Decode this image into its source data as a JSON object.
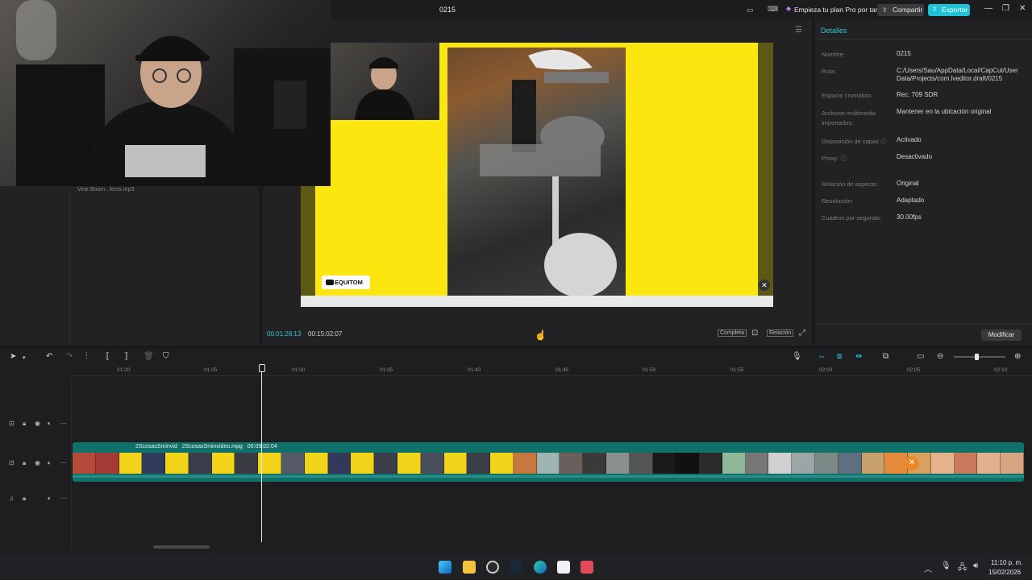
{
  "window": {
    "project_title": "0215",
    "pro_plan": "Empieza tu plan Pro por tar",
    "share_label": "Compartir",
    "export_label": "Exportar",
    "minimize": "—",
    "restore": "❐",
    "close": "✕"
  },
  "media": {
    "file_label": "Vine Boom...fects.mp3"
  },
  "preview": {
    "logo_text": "EQUITOM"
  },
  "player": {
    "current_time": "00:01:28:13",
    "total_time": "00:15:02:07",
    "full_label": "Completa",
    "ratio_label": "Relación"
  },
  "details": {
    "header": "Detalles",
    "rows": [
      {
        "label": "Nombre:",
        "value": "0215"
      },
      {
        "label": "Ruta:",
        "value": "C:/Users/Sau/AppData/Local/CapCut/User Data/Projects/com.lveditor.draft/0215"
      },
      {
        "label": "Espacio cromático",
        "value": "Rec. 709 SDR"
      },
      {
        "label": "Archivos multimedia importados:",
        "value": "Mantener en la ubicación original"
      },
      {
        "label": "Disposición de capas ⓘ",
        "value": "Activado"
      },
      {
        "label": "Proxy: ⓘ",
        "value": "Desactivado"
      },
      {
        "label": "Relación de aspecto:",
        "value": "Original"
      },
      {
        "label": "Resolución:",
        "value": "Adaptado"
      },
      {
        "label": "Cuadros por segundo:",
        "value": "30.00fps"
      }
    ],
    "modify_label": "Modificar"
  },
  "timeline": {
    "ruler": [
      "01:20",
      "01:25",
      "01:30",
      "01:35",
      "01:40",
      "01:45",
      "01:50",
      "01:55",
      "02:00",
      "02:05",
      "02:10"
    ],
    "clip_label_a": "2ScosasSminvid",
    "clip_label_b": "2ScosasSminvideo.mpg",
    "clip_duration": "00:09:02:04",
    "frame_colors": [
      "#b44a3a",
      "#a33a34",
      "#f2d41a",
      "#2f3b5a",
      "#f2d41a",
      "#3b3e4a",
      "#f2d41a",
      "#3a3a42",
      "#f2d41a",
      "#545a66",
      "#f2d41a",
      "#32385a",
      "#f2d41a",
      "#3b3e4a",
      "#f2d41a",
      "#4a4f5d",
      "#f2d41a",
      "#3a3e47",
      "#f2d41a",
      "#c8773e",
      "#9fb3b0",
      "#6a5f5c",
      "#3a3a3a",
      "#8a9090",
      "#555",
      "#1a1a1a",
      "#111",
      "#2a2a2a",
      "#8fb89a",
      "#777",
      "#cfd0d0",
      "#9aa5a5",
      "#7b8a86",
      "#5e6f80",
      "#c8a06a",
      "#e58a3a",
      "#d9a060",
      "#e6b38a",
      "#c97a5a",
      "#e0b090",
      "#d8a582"
    ]
  },
  "taskbar": {
    "time": "11:10 p. m.",
    "date": "15/02/2026",
    "icons": [
      "windows-start-icon",
      "file-explorer-icon",
      "chrome-icon",
      "steam-icon",
      "edge-icon",
      "capcut-icon",
      "snipping-tool-icon"
    ]
  },
  "colors": {
    "accent": "#2ec7d9",
    "export": "#1fc1d6",
    "clip": "#10706a",
    "preview_bg": "#fbe70f"
  }
}
